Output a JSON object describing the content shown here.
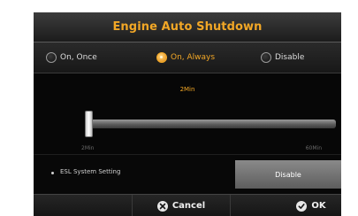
{
  "dialog": {
    "title": "Engine Auto Shutdown"
  },
  "options": [
    {
      "label": "On, Once",
      "selected": false
    },
    {
      "label": "On, Always",
      "selected": true
    },
    {
      "label": "Disable",
      "selected": false
    }
  ],
  "slider": {
    "value_label": "2Min",
    "min_label": "2Min",
    "max_label": "60Min",
    "value_fraction": 0.0
  },
  "esl": {
    "label": "ESL System Setting",
    "button_label": "Disable"
  },
  "buttons": {
    "cancel_label": "Cancel",
    "ok_label": "OK"
  },
  "colors": {
    "accent": "#f2a726",
    "background": "#050505"
  },
  "icons": {
    "cancel": "x-circle-icon",
    "ok": "check-circle-icon"
  }
}
